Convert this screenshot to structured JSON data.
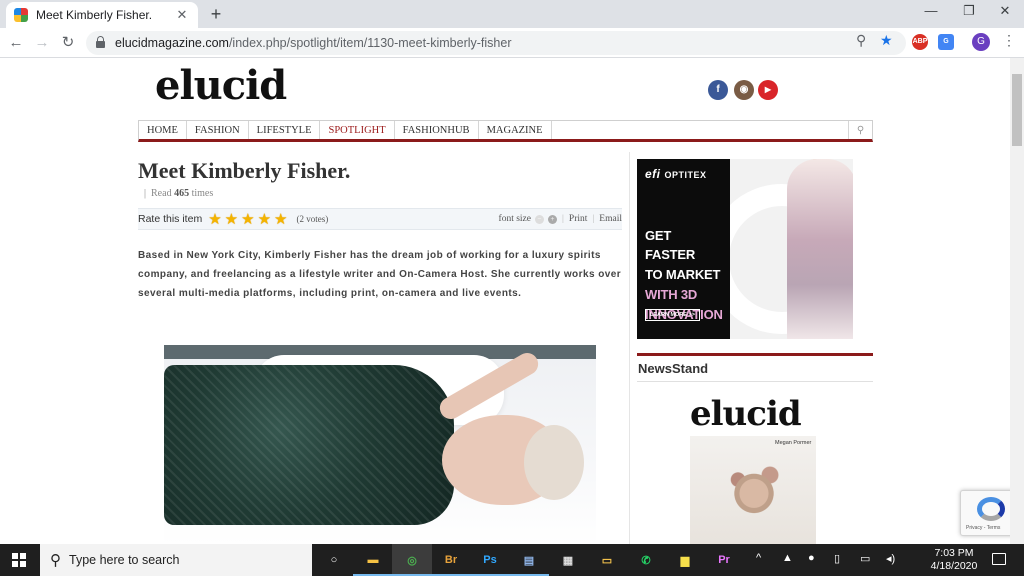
{
  "browser": {
    "tab_title": "Meet Kimberly Fisher.",
    "tab_close": "✕",
    "new_tab": "+",
    "url_host": "elucidmagazine.com",
    "url_path": "/index.php/spotlight/item/1130-meet-kimberly-fisher",
    "profile_initial": "G",
    "extension_badge_label": "ABP",
    "translate_label": "G"
  },
  "site": {
    "logo": "elucid",
    "nav": [
      "HOME",
      "FASHION",
      "LIFESTYLE",
      "SPOTLIGHT",
      "FASHIONHUB",
      "MAGAZINE"
    ],
    "active_nav": "SPOTLIGHT",
    "social": [
      {
        "name": "facebook",
        "glyph": "f",
        "color": "#3b5998"
      },
      {
        "name": "instagram",
        "glyph": "◉",
        "color": "#7a5c45"
      },
      {
        "name": "youtube",
        "glyph": "▶",
        "color": "#d9252a"
      }
    ]
  },
  "article": {
    "title": "Meet Kimberly Fisher.",
    "hits_prefix": "Read",
    "hits_count": "465",
    "hits_suffix": "times",
    "rate_label": "Rate this item",
    "rating": 5,
    "rating_max": 5,
    "votes": "(2 votes)",
    "font_size_label": "font size",
    "print_label": "Print",
    "email_label": "Email",
    "body": "Based in New York City, Kimberly Fisher has the dream job of working for a luxury spirits company, and freelancing as a lifestyle writer and On-Camera Host. She currently works over several multi-media platforms, including print, on-camera and live events."
  },
  "ad": {
    "brand_mark": "efi",
    "brand_name": "OPTITEX",
    "lines": [
      "GET FASTER",
      "TO MARKET"
    ],
    "pink_lines": [
      "WITH 3D",
      "INNOVATION"
    ],
    "cta": "LEARN MORE >>"
  },
  "sidebar": {
    "newsstand_title": "NewsStand",
    "magazine_logo": "elucid",
    "magazine_cover_name": "Megan Pormer"
  },
  "recaptcha": {
    "text": "Privacy - Terms"
  },
  "taskbar": {
    "search_placeholder": "Type here to search",
    "time": "7:03 PM",
    "date": "4/18/2020",
    "apps": [
      {
        "name": "task-view",
        "glyph": "○",
        "color": "#ffffff"
      },
      {
        "name": "file-explorer",
        "glyph": "▬",
        "color": "#f6c244"
      },
      {
        "name": "chrome",
        "glyph": "◎",
        "color": "#4caf50"
      },
      {
        "name": "bridge",
        "glyph": "Br",
        "color": "#e8a33c"
      },
      {
        "name": "photoshop",
        "glyph": "Ps",
        "color": "#31a8ff"
      },
      {
        "name": "word-doc",
        "glyph": "▤",
        "color": "#8fb4e8"
      },
      {
        "name": "calculator",
        "glyph": "▦",
        "color": "#dddddd"
      },
      {
        "name": "file-manager",
        "glyph": "▭",
        "color": "#f3c24c"
      },
      {
        "name": "whatsapp",
        "glyph": "✆",
        "color": "#25d366"
      },
      {
        "name": "sticky-notes",
        "glyph": "▆",
        "color": "#f7e04b"
      },
      {
        "name": "premiere",
        "glyph": "Pr",
        "color": "#ea77ff"
      }
    ],
    "tray": [
      "^",
      "▲",
      "●",
      "▯",
      "▭",
      "◂)"
    ]
  }
}
